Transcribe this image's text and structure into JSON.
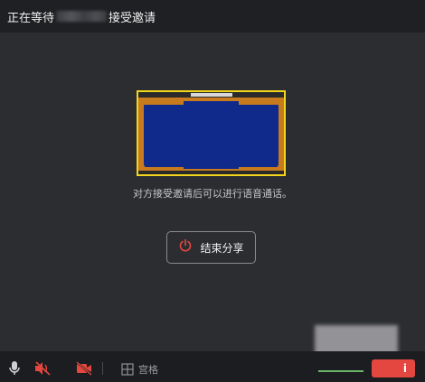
{
  "window": {
    "title_prefix": "正在等待",
    "title_suffix": "接受邀请"
  },
  "preview": {
    "description_colors": {
      "frame": "#f2d61c",
      "bezel": "#c77a1e",
      "screen": "#0f2a8a"
    }
  },
  "main": {
    "waiting_message": "对方接受邀请后可以进行语音通话。",
    "end_button_label": "结束分享"
  },
  "toolbar": {
    "mic": {
      "icon": "microphone-icon"
    },
    "speaker": {
      "icon": "speaker-muted-icon",
      "state": "muted"
    },
    "camera": {
      "icon": "camera-off-icon",
      "state": "off"
    },
    "grid_label": "宫格",
    "right_button_label": "i"
  },
  "colors": {
    "background": "#2b2d31",
    "titlebar": "#1f2023",
    "bottombar": "#1c1d20",
    "danger": "#e4473f"
  }
}
